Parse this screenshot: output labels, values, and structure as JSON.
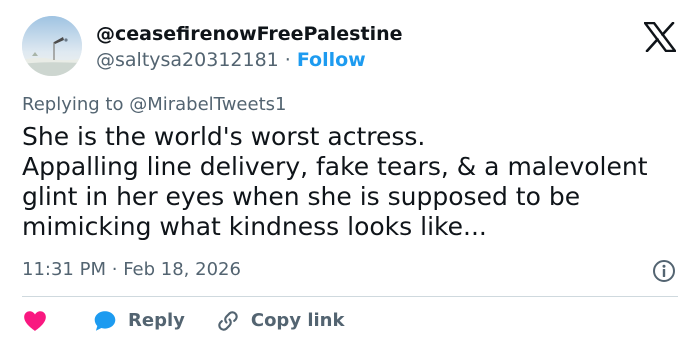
{
  "author": {
    "display_name": "@ceasefirenowFreePalestine",
    "handle": "@saltysa20312181",
    "separator": "·",
    "follow_label": "Follow"
  },
  "reply_context": {
    "prefix": "Replying to",
    "mention": "@MirabelTweets1"
  },
  "tweet": {
    "lines": [
      "She is the world's worst actress.",
      "Appalling line delivery, fake tears, & a malevolent",
      "glint in her eyes when she is supposed to be",
      "mimicking what kindness looks like..."
    ],
    "time": "11:31 PM",
    "separator": "·",
    "date": "Feb 18, 2026"
  },
  "actions": {
    "reply_label": "Reply",
    "copy_link_label": "Copy link"
  },
  "icons": {
    "logo": "x-logo-icon",
    "info": "info-icon",
    "like": "heart-icon",
    "reply": "speech-bubble-icon",
    "copy_link": "link-icon"
  },
  "colors": {
    "text": "#0f1419",
    "secondary": "#536471",
    "link": "#1d9bf0",
    "like": "#f91880",
    "divider": "#cfd9de"
  }
}
